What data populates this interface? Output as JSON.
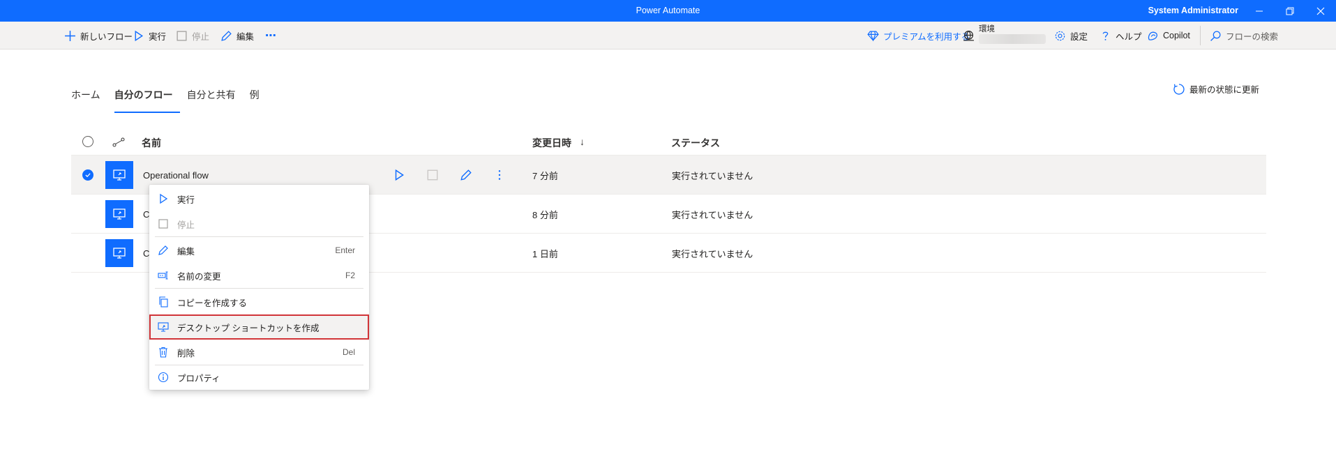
{
  "window": {
    "title": "Power Automate",
    "user": "System Administrator"
  },
  "toolbar": {
    "new_flow": "新しいフロー",
    "run": "実行",
    "stop": "停止",
    "edit": "編集",
    "more": "⋯",
    "premium": "プレミアムを利用する",
    "environment_label": "環境",
    "settings": "設定",
    "help": "ヘルプ",
    "copilot": "Copilot",
    "search": "フローの検索"
  },
  "tabs": [
    "ホーム",
    "自分のフロー",
    "自分と共有",
    "例"
  ],
  "active_tab": "自分のフロー",
  "refresh_label": "最新の状態に更新",
  "table": {
    "headers": {
      "name": "名前",
      "modified": "変更日時",
      "sort_arrow": "↓",
      "status": "ステータス"
    },
    "rows": [
      {
        "name": "Operational flow",
        "modified": "7 分前",
        "status": "実行されていません",
        "selected": true
      },
      {
        "name": "C",
        "modified": "8 分前",
        "status": "実行されていません",
        "selected": false
      },
      {
        "name": "C",
        "modified": "1 日前",
        "status": "実行されていません",
        "selected": false
      }
    ]
  },
  "context_menu": {
    "run": "実行",
    "stop": "停止",
    "edit": "編集",
    "edit_shortcut": "Enter",
    "rename": "名前の変更",
    "rename_shortcut": "F2",
    "copy": "コピーを作成する",
    "desktop_shortcut": "デスクトップ ショートカットを作成",
    "delete": "削除",
    "delete_shortcut": "Del",
    "properties": "プロパティ"
  },
  "colors": {
    "accent": "#0f6cff",
    "highlight_border": "#d13438"
  }
}
